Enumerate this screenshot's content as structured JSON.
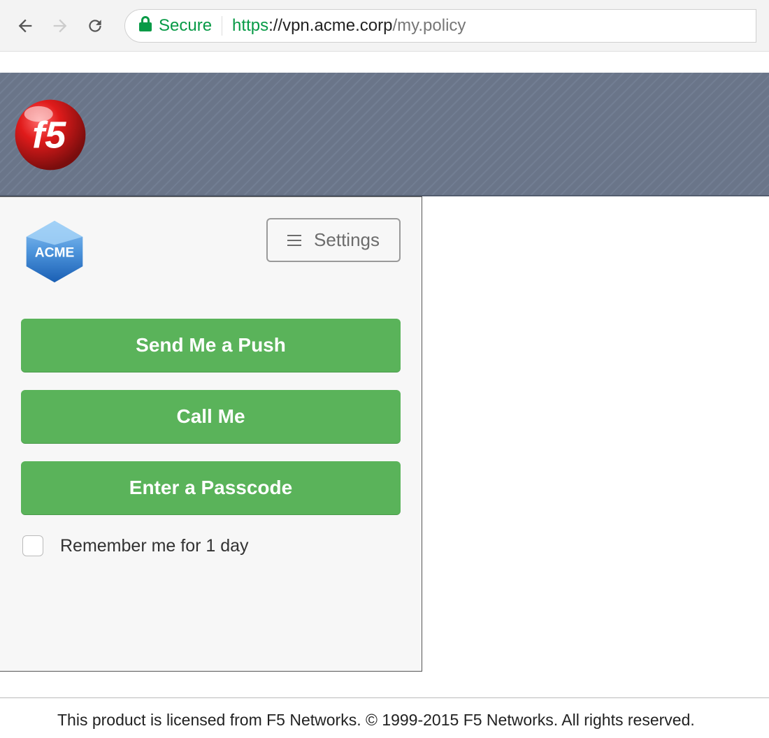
{
  "browser": {
    "secure_label": "Secure",
    "url_proto": "https",
    "url_host": "://vpn.acme.corp",
    "url_path": "/my.policy"
  },
  "banner": {
    "logo_text": "f5"
  },
  "duo": {
    "org_logo_text": "ACME",
    "settings_label": "Settings",
    "buttons": {
      "push": "Send Me a Push",
      "call": "Call Me",
      "passcode": "Enter a Passcode"
    },
    "remember_label": "Remember me for 1 day"
  },
  "footer": {
    "text": "This product is licensed from F5 Networks. © 1999-2015 F5 Networks. All rights reserved."
  },
  "colors": {
    "accent_green": "#5ab35a",
    "banner_bg": "#6a7589",
    "secure_green": "#079a46"
  }
}
